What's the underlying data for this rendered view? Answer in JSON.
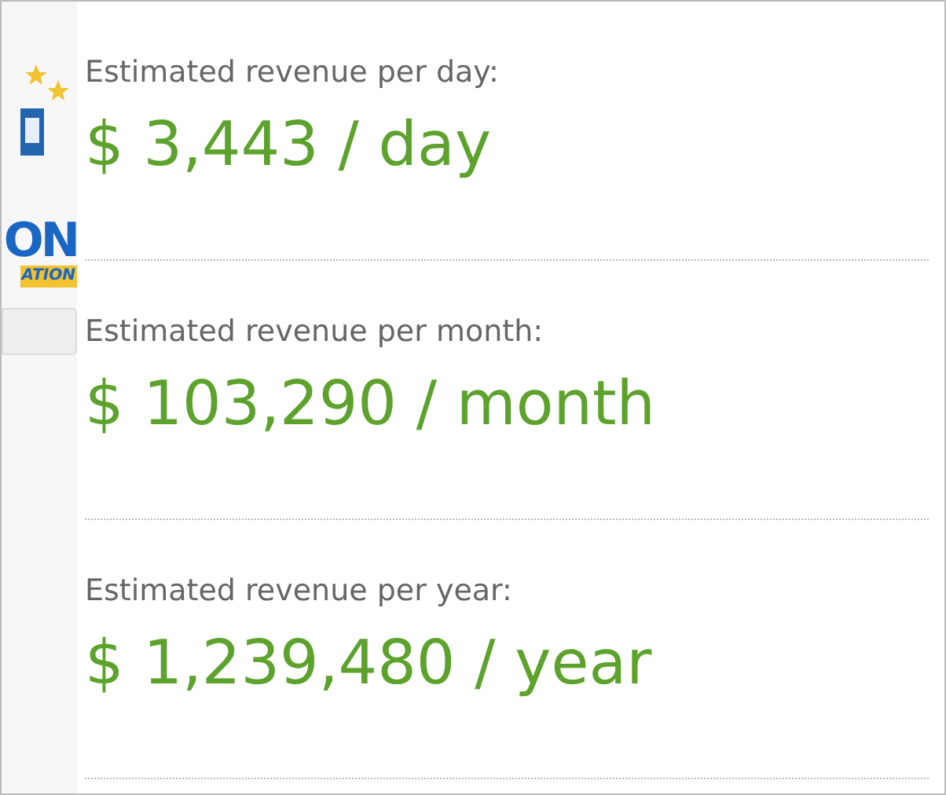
{
  "logo": {
    "line_1": "ON",
    "line_2": "ATION"
  },
  "estimates": [
    {
      "label": "Estimated revenue per day:",
      "value": "$ 3,443 / day"
    },
    {
      "label": "Estimated revenue per month:",
      "value": "$ 103,290 / month"
    },
    {
      "label": "Estimated revenue per year:",
      "value": "$ 1,239,480 / year"
    }
  ]
}
